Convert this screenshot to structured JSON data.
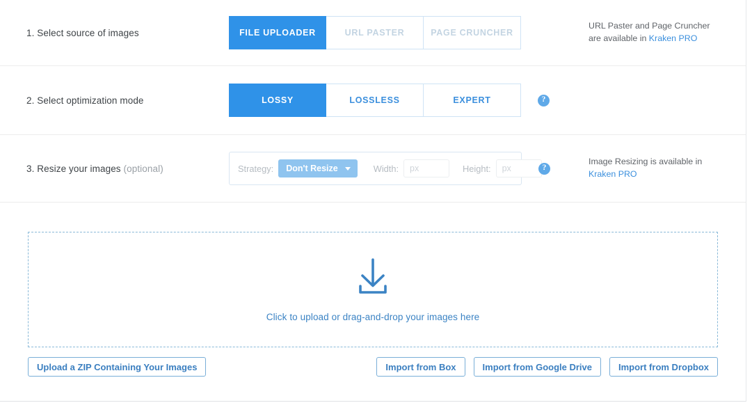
{
  "steps": {
    "source": {
      "label": "1. Select source of images",
      "options": [
        {
          "label": "FILE UPLOADER",
          "state": "active"
        },
        {
          "label": "URL PASTER",
          "state": "disabled"
        },
        {
          "label": "PAGE CRUNCHER",
          "state": "disabled"
        }
      ],
      "note_line1": "URL Paster and Page Cruncher",
      "note_line2_prefix": "are available in ",
      "note_link": "Kraken PRO"
    },
    "mode": {
      "label": "2. Select optimization mode",
      "options": [
        {
          "label": "LOSSY",
          "state": "active"
        },
        {
          "label": "LOSSLESS",
          "state": "normal"
        },
        {
          "label": "EXPERT",
          "state": "normal"
        }
      ],
      "help": "?"
    },
    "resize": {
      "label_main": "3. Resize your images ",
      "label_optional": "(optional)",
      "strategy_label": "Strategy:",
      "strategy_value": "Don't Resize",
      "width_label": "Width:",
      "width_value": "",
      "width_placeholder": "px",
      "height_label": "Height:",
      "height_value": "",
      "height_placeholder": "px",
      "help": "?",
      "note_line1": "Image Resizing is available in",
      "note_link": "Kraken PRO"
    }
  },
  "dropzone": {
    "icon": "download-arrow-icon",
    "text": "Click to upload or drag-and-drop your images here"
  },
  "bottom_buttons": {
    "zip": "Upload a ZIP Containing Your Images",
    "box": "Import from Box",
    "google_drive": "Import from Google Drive",
    "dropbox": "Import from Dropbox"
  },
  "colors": {
    "accent": "#2f92e8",
    "accent_light": "#8fc4ef",
    "link": "#3b8fdd",
    "outline": "#79aed8",
    "dashed_border": "#89b9d8"
  }
}
